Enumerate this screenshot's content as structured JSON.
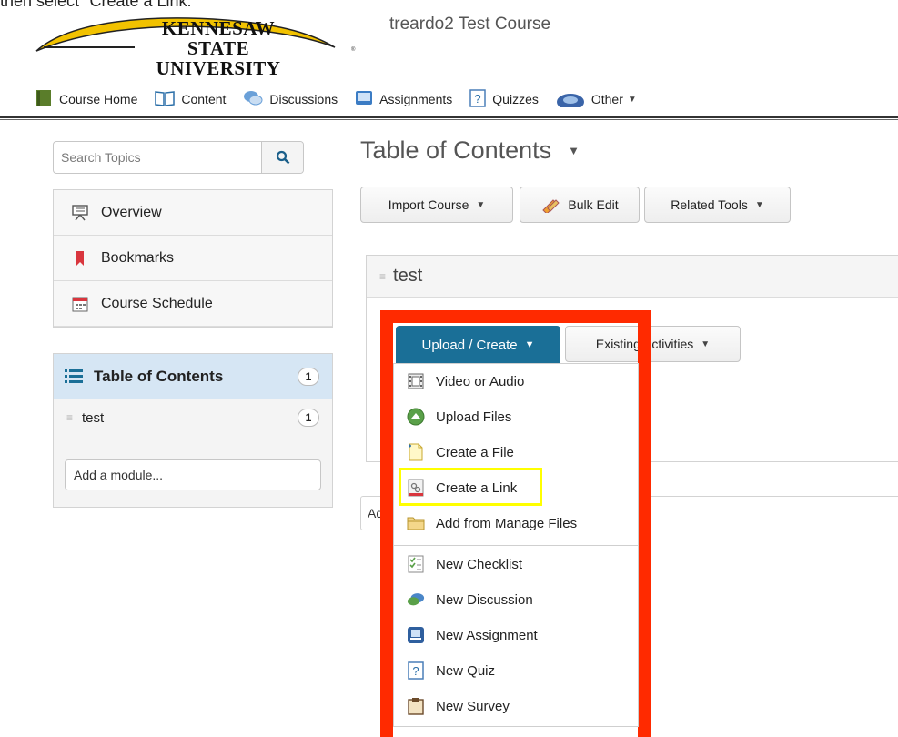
{
  "caption": {
    "text": "then select \"Create a Link.\""
  },
  "header": {
    "logo_line1": "KENNESAW",
    "logo_line2": "STATE UNIVERSITY",
    "logo_reg": "®",
    "course_title": "treardo2 Test Course"
  },
  "nav": {
    "items": [
      {
        "label": "Course Home",
        "icon": "book-icon"
      },
      {
        "label": "Content",
        "icon": "open-book-icon"
      },
      {
        "label": "Discussions",
        "icon": "chat-bubbles-icon"
      },
      {
        "label": "Assignments",
        "icon": "dropbox-icon"
      },
      {
        "label": "Quizzes",
        "icon": "quiz-icon"
      },
      {
        "label": "Other",
        "icon": "globe-icon"
      }
    ]
  },
  "sidebar": {
    "search_placeholder": "Search Topics",
    "items": [
      {
        "label": "Overview",
        "icon": "presentation-icon"
      },
      {
        "label": "Bookmarks",
        "icon": "bookmark-icon"
      },
      {
        "label": "Course Schedule",
        "icon": "calendar-icon"
      }
    ],
    "toc": {
      "label": "Table of Contents",
      "count": "1",
      "modules": [
        {
          "label": "test",
          "count": "1"
        }
      ],
      "add_module_placeholder": "Add a module..."
    }
  },
  "main": {
    "title": "Table of Contents",
    "toolbar": {
      "import_label": "Import Course",
      "bulk_edit_label": "Bulk Edit",
      "related_tools_label": "Related Tools"
    },
    "module_title": "test",
    "upload_create_label": "Upload / Create",
    "existing_activities_label": "Existing Activities",
    "peek_text": "Ad"
  },
  "menu": {
    "items": [
      {
        "label": "Video or Audio",
        "icon": "film-icon"
      },
      {
        "label": "Upload Files",
        "icon": "upload-icon"
      },
      {
        "label": "Create a File",
        "icon": "new-file-icon"
      },
      {
        "label": "Create a Link",
        "icon": "link-icon"
      },
      {
        "label": "Add from Manage Files",
        "icon": "folder-icon"
      },
      {
        "label": "New Checklist",
        "icon": "checklist-icon"
      },
      {
        "label": "New Discussion",
        "icon": "discussion-icon"
      },
      {
        "label": "New Assignment",
        "icon": "assignment-icon"
      },
      {
        "label": "New Quiz",
        "icon": "quiz-icon"
      },
      {
        "label": "New Survey",
        "icon": "clipboard-icon"
      }
    ]
  },
  "colors": {
    "upload_button": "#1a6f97",
    "annotation_red": "#ff2a00",
    "annotation_yellow": "#ffff00",
    "toc_highlight": "#d6e6f4"
  }
}
